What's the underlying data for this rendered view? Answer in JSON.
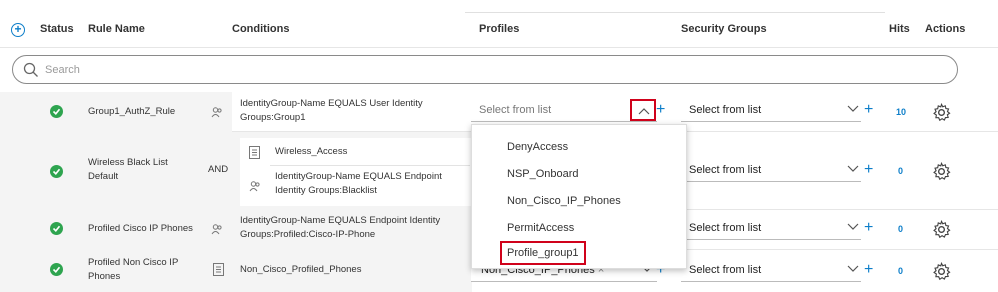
{
  "columns": {
    "status": "Status",
    "rule_name": "Rule Name",
    "conditions": "Conditions",
    "profiles": "Profiles",
    "security_groups": "Security Groups",
    "hits": "Hits",
    "actions": "Actions"
  },
  "search": {
    "placeholder": "Search"
  },
  "rows": [
    {
      "rule_name": "Group1_AuthZ_Rule",
      "condition": "IdentityGroup-Name  EQUALS  User Identity Groups:Group1",
      "profile": "Select from list",
      "security_group": "Select from list",
      "hits": "10"
    },
    {
      "rule_name": "Wireless Black List Default",
      "operator": "AND",
      "condition_1": "Wireless_Access",
      "condition_2": "IdentityGroup-Name  EQUALS  Endpoint Identity Groups:Blacklist",
      "security_group": "Select from list",
      "hits": "0"
    },
    {
      "rule_name": "Profiled Cisco IP Phones",
      "condition": "IdentityGroup-Name  EQUALS  Endpoint Identity Groups:Profiled:Cisco-IP-Phone",
      "security_group": "Select from list",
      "hits": "0"
    },
    {
      "rule_name": "Profiled Non Cisco IP Phones",
      "condition": "Non_Cisco_Profiled_Phones",
      "profile": "Non_Cisco_IP_Phones",
      "security_group": "Select from list",
      "hits": "0"
    }
  ],
  "profile_dropdown": {
    "options": [
      "DenyAccess",
      "NSP_Onboard",
      "Non_Cisco_IP_Phones",
      "PermitAccess",
      "Profile_group1"
    ],
    "highlighted": "Profile_group1"
  },
  "colors": {
    "accent": "#0d7ec9",
    "status_ok": "#2ea44f",
    "highlight": "#d0021b"
  }
}
